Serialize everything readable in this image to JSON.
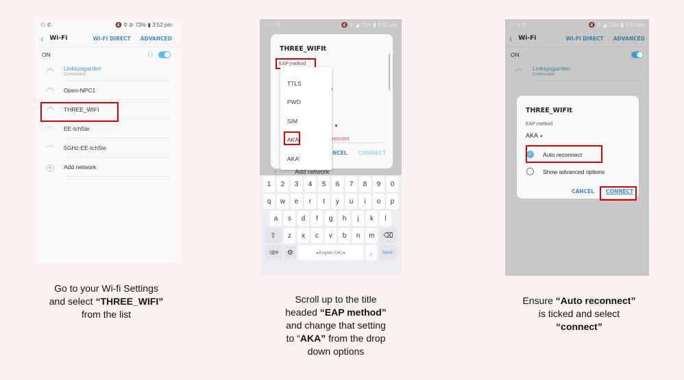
{
  "steps": [
    {
      "screen": {
        "status": {
          "left": "⚇ ✆",
          "right": "🔇 ⚲ ⊘ 73% ▮ 3:52 pm"
        },
        "appbar": {
          "title": "Wi-Fi",
          "action1": "WI-FI DIRECT",
          "action2": "ADVANCED"
        },
        "on_label": "ON",
        "networks": [
          {
            "name": "Linksysgarden",
            "sub": "Connected"
          },
          {
            "name": "Open-NPC1"
          },
          {
            "name": "THREE_WIFI"
          },
          {
            "name": "EE-tch5te"
          },
          {
            "name": "5GHz-EE-tch5te"
          }
        ],
        "add_network": "Add network"
      },
      "caption": {
        "line1": "Go to your Wi-fi Settings",
        "line2a": "and select ",
        "line2b": "“THREE_WIFI”",
        "line3": "from the list"
      }
    },
    {
      "screen": {
        "status": {
          "left": "⚇ ⚇ ✆",
          "right": "🔇 ⚲ ◢ 71% ▮ 3:53 pm"
        },
        "dialog_title": "THREE_WIFIt",
        "eap_label": "EAP method",
        "eap_options": [
          "TTLS",
          "PWD",
          "SIM",
          "AKA",
          "AKA'"
        ],
        "partial_text": "n",
        "error_text": "selected",
        "cancel": "NCEL",
        "connect": "CONNECT",
        "add_network": "Add network",
        "keyboard": {
          "row1": [
            "1",
            "2",
            "3",
            "4",
            "5",
            "6",
            "7",
            "8",
            "9",
            "0"
          ],
          "row2": [
            "q",
            "w",
            "e",
            "r",
            "t",
            "y",
            "u",
            "i",
            "o",
            "p"
          ],
          "row3": [
            "a",
            "s",
            "d",
            "f",
            "g",
            "h",
            "j",
            "k",
            "l"
          ],
          "row4": [
            "z",
            "x",
            "c",
            "v",
            "b",
            "n",
            "m"
          ],
          "symbols": "!@#",
          "space": "◂ English (UK) ▸",
          "period": ".",
          "next": "Next"
        }
      },
      "caption": {
        "line1": "Scroll up to the title",
        "line2a": "headed ",
        "line2b": "“EAP method”",
        "line3": "and change that setting",
        "line4a": "to “",
        "line4b": "AKA”",
        "line4c": " from the drop",
        "line5": "down options"
      }
    },
    {
      "screen": {
        "status": {
          "left": "⚇ ⚇ ✆",
          "right": "🔇 ⚲ ◢ 71% ▮ 3:53 pm"
        },
        "appbar": {
          "title": "Wi-Fi",
          "action1": "WI-FI DIRECT",
          "action2": "ADVANCED"
        },
        "on_label": "ON",
        "network": {
          "name": "Linksysgarden",
          "sub": "Connected"
        },
        "dialog_title": "THREE_WIFIt",
        "eap_label": "EAP method",
        "eap_value": "AKA",
        "auto_reconnect": "Auto reconnect",
        "advanced": "Show advanced options",
        "cancel": "CANCEL",
        "connect": "CONNECT"
      },
      "caption": {
        "line1a": "Ensure ",
        "line1b": "“Auto reconnect”",
        "line2": "is ticked and select",
        "line3": "“connect”"
      }
    }
  ]
}
